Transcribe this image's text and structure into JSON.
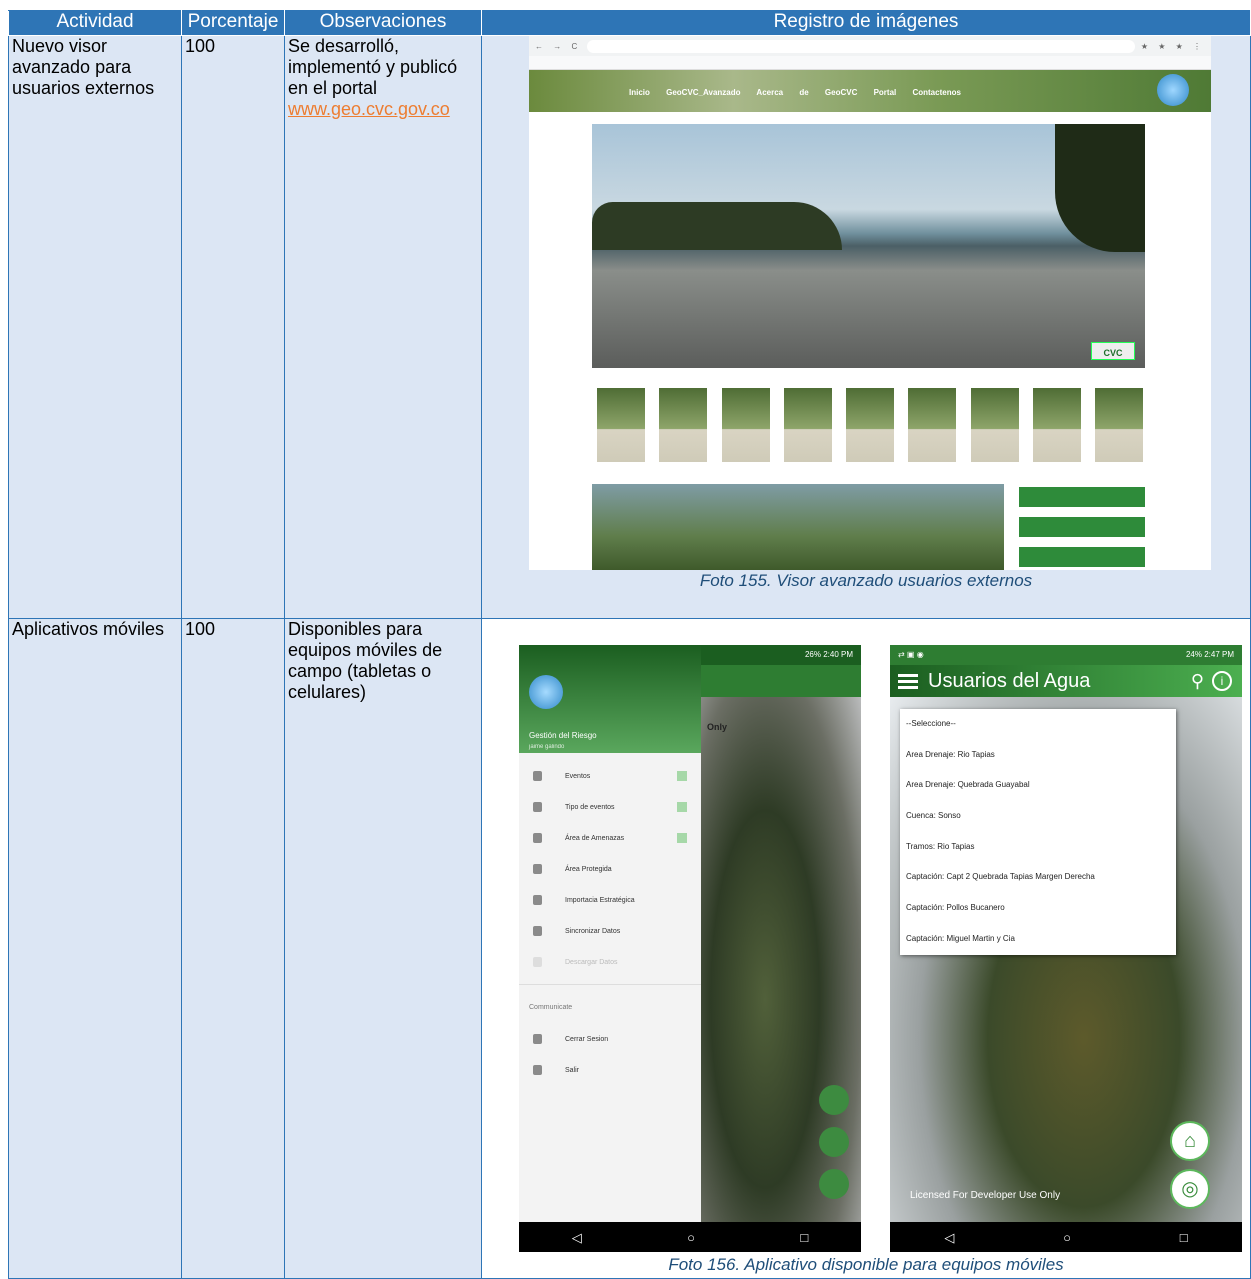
{
  "table": {
    "headers": [
      "Actividad",
      "Porcentaje",
      "Observaciones",
      "Registro de imágenes"
    ],
    "rows": [
      {
        "actividad": "Nuevo visor avanzado para usuarios externos",
        "porcentaje": "100",
        "observaciones": "Se desarrolló, implementó y publicó en el portal",
        "link": "www.geo.cvc.gov.co",
        "caption": "Foto 155. Visor avanzado usuarios externos"
      },
      {
        "actividad": "Aplicativos móviles",
        "porcentaje": "100",
        "observaciones": "Disponibles para equipos móviles de campo (tabletas o celulares)",
        "caption": "Foto 156. Aplicativo disponible para equipos móviles"
      }
    ]
  },
  "browser": {
    "menu": "Inicio GeoCVC_Avanzado Acerca de GeoCVC Portal Contactenos",
    "logo_text": "CVC"
  },
  "phone1": {
    "status_time": "26% 2:40 PM",
    "drawer_title": "Gestión del Riesgo",
    "drawer_user": "jaime galindo",
    "items": [
      "Eventos",
      "Tipo de eventos",
      "Área de Amenazas",
      "Área Protegida",
      "Importacia Estratégica",
      "Sincronizar Datos",
      "Descargar Datos"
    ],
    "section": "Communicate",
    "items2": [
      "Cerrar Sesion",
      "Salir"
    ],
    "map_text": "Only"
  },
  "phone2": {
    "status_time": "24% 2:47 PM",
    "title": "Usuarios del Agua",
    "options": [
      "--Seleccione--",
      "Area Drenaje: Rio Tapias",
      "Area Drenaje: Quebrada Guayabal",
      "Cuenca: Sonso",
      "Tramos: Rio Tapias",
      "Captación: Capt 2 Quebrada Tapias Margen Derecha",
      "Captación: Pollos Bucanero",
      "Captación: Miguel Martin y Cia"
    ],
    "watermark": "Licensed For Developer Use Only"
  },
  "colors": {
    "header_bg": "#2e75b6",
    "cell_bg": "#dce6f4",
    "link": "#ed7d31",
    "caption": "#1f4e79"
  }
}
